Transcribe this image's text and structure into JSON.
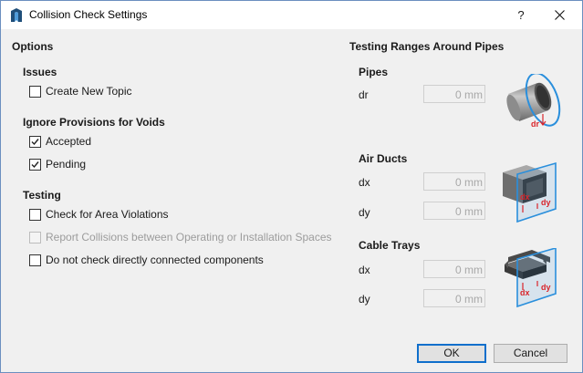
{
  "window": {
    "title": "Collision Check Settings",
    "help_label": "?"
  },
  "options": {
    "heading": "Options",
    "issues": {
      "heading": "Issues",
      "create_new_topic": {
        "label": "Create New Topic",
        "checked": false
      }
    },
    "ignore_provisions": {
      "heading": "Ignore Provisions for Voids",
      "accepted": {
        "label": "Accepted",
        "checked": true
      },
      "pending": {
        "label": "Pending",
        "checked": true
      }
    },
    "testing": {
      "heading": "Testing",
      "area_violations": {
        "label": "Check for Area Violations",
        "checked": false
      },
      "report_collisions": {
        "label": "Report Collisions between Operating or Installation Spaces",
        "checked": false,
        "enabled": false
      },
      "no_connected": {
        "label": "Do not check directly connected components",
        "checked": false
      }
    }
  },
  "ranges": {
    "heading": "Testing Ranges Around Pipes",
    "pipes": {
      "heading": "Pipes",
      "dr": {
        "label": "dr",
        "value": "0 mm"
      },
      "illustration_label": "dr"
    },
    "air_ducts": {
      "heading": "Air Ducts",
      "dx": {
        "label": "dx",
        "value": "0 mm"
      },
      "dy": {
        "label": "dy",
        "value": "0 mm"
      },
      "illustration_labels": {
        "dx": "dx",
        "dy": "dy"
      }
    },
    "cable_trays": {
      "heading": "Cable Trays",
      "dx": {
        "label": "dx",
        "value": "0 mm"
      },
      "dy": {
        "label": "dy",
        "value": "0 mm"
      },
      "illustration_labels": {
        "dx": "dx",
        "dy": "dy"
      }
    }
  },
  "buttons": {
    "ok": "OK",
    "cancel": "Cancel"
  },
  "colors": {
    "accent": "#0f6fcc",
    "illustration_blue": "#2a8fdc",
    "illustration_red": "#d9252b"
  }
}
